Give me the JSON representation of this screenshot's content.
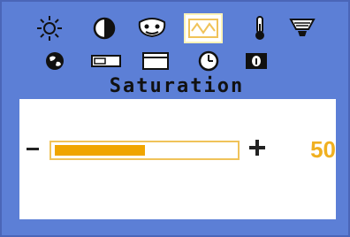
{
  "menu": {
    "title": "Saturation",
    "icons_row1": [
      "brightness-icon",
      "contrast-icon",
      "color-mask-icon",
      "saturation-wave-icon",
      "color-temperature-icon",
      "image-settings-icon"
    ],
    "icons_row2": [
      "language-globe-icon",
      "h-position-icon",
      "v-size-icon",
      "osd-timer-icon",
      "information-icon"
    ],
    "selected_icon": "saturation-wave-icon"
  },
  "slider": {
    "minus_label": "-",
    "plus_label": "+",
    "value": 50,
    "value_text": "50",
    "fill_fraction": 0.5
  },
  "colors": {
    "background": "#5c7fd6",
    "accent": "#f0a500",
    "value": "#f0b020"
  }
}
